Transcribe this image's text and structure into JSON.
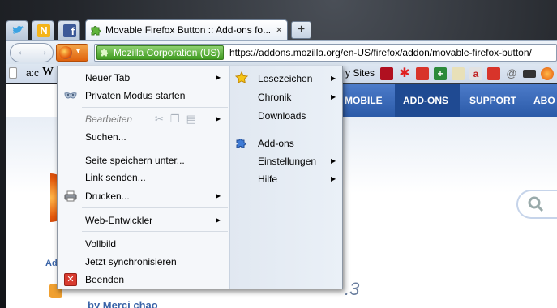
{
  "tabs": [
    {
      "icon": "twitter-icon"
    },
    {
      "icon": "n-icon"
    },
    {
      "icon": "facebook-icon"
    },
    {
      "title": "Movable Firefox Button :: Add-ons fo...",
      "close": "×"
    }
  ],
  "new_tab_symbol": "+",
  "nav": {
    "back": "←",
    "forward": "→",
    "firefox_arrow": "▾",
    "identity": "Mozilla Corporation (US)",
    "url": "https://addons.mozilla.org/en-US/firefox/addon/movable-firefox-button/"
  },
  "bookmarks": {
    "first": "a:c",
    "second": "W",
    "most_visited": "y Sites"
  },
  "page": {
    "nav_items": [
      "MOBILE",
      "ADD-ONS",
      "SUPPORT",
      "ABO"
    ],
    "side_text": "Ad",
    "version_fragment": ".3",
    "author_fragment": "by Merci chao"
  },
  "menu": {
    "left": {
      "new_tab": "Neuer Tab",
      "private": "Privaten Modus starten",
      "edit": "Bearbeiten",
      "find": "Suchen...",
      "save_page": "Seite speichern unter...",
      "send_link": "Link senden...",
      "print": "Drucken...",
      "web_dev": "Web-Entwickler",
      "fullscreen": "Vollbild",
      "sync": "Jetzt synchronisieren",
      "quit": "Beenden"
    },
    "right": {
      "bookmarks": "Lesezeichen",
      "history": "Chronik",
      "downloads": "Downloads",
      "addons": "Add-ons",
      "settings": "Einstellungen",
      "help": "Hilfe"
    },
    "submenu_arrow": "▶"
  }
}
